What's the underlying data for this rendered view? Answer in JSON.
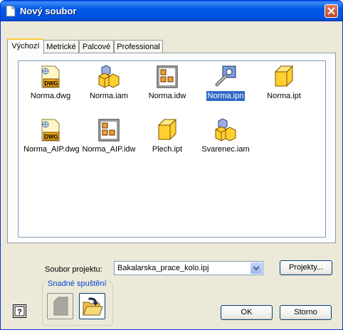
{
  "window": {
    "title": "Nový soubor"
  },
  "tabs": [
    {
      "label": "Výchozí",
      "active": true
    },
    {
      "label": "Metrické",
      "active": false
    },
    {
      "label": "Palcové",
      "active": false
    },
    {
      "label": "Professional",
      "active": false
    }
  ],
  "files": [
    {
      "label": "Norma.dwg",
      "icon": "dwg-file-icon"
    },
    {
      "label": "Norma.iam",
      "icon": "assembly-file-icon"
    },
    {
      "label": "Norma.idw",
      "icon": "drawing-file-icon"
    },
    {
      "label": "Norma.ipn",
      "icon": "presentation-file-icon",
      "selected": true
    },
    {
      "label": "Norma.ipt",
      "icon": "part-file-icon"
    },
    {
      "label": "Norma_AIP.dwg",
      "icon": "dwg-file-icon"
    },
    {
      "label": "Norma_AIP.idw",
      "icon": "drawing-file-icon"
    },
    {
      "label": "Plech.ipt",
      "icon": "part-file-icon"
    },
    {
      "label": "Svarenec.iam",
      "icon": "assembly-file-icon"
    }
  ],
  "project": {
    "label": "Soubor projektu:",
    "value": "Bakalarska_prace_kolo.ipj",
    "projects_button": "Projekty..."
  },
  "quick_launch": {
    "label": "Snadné spuštění"
  },
  "buttons": {
    "ok": "OK",
    "cancel": "Storno",
    "help_glyph": "?"
  }
}
